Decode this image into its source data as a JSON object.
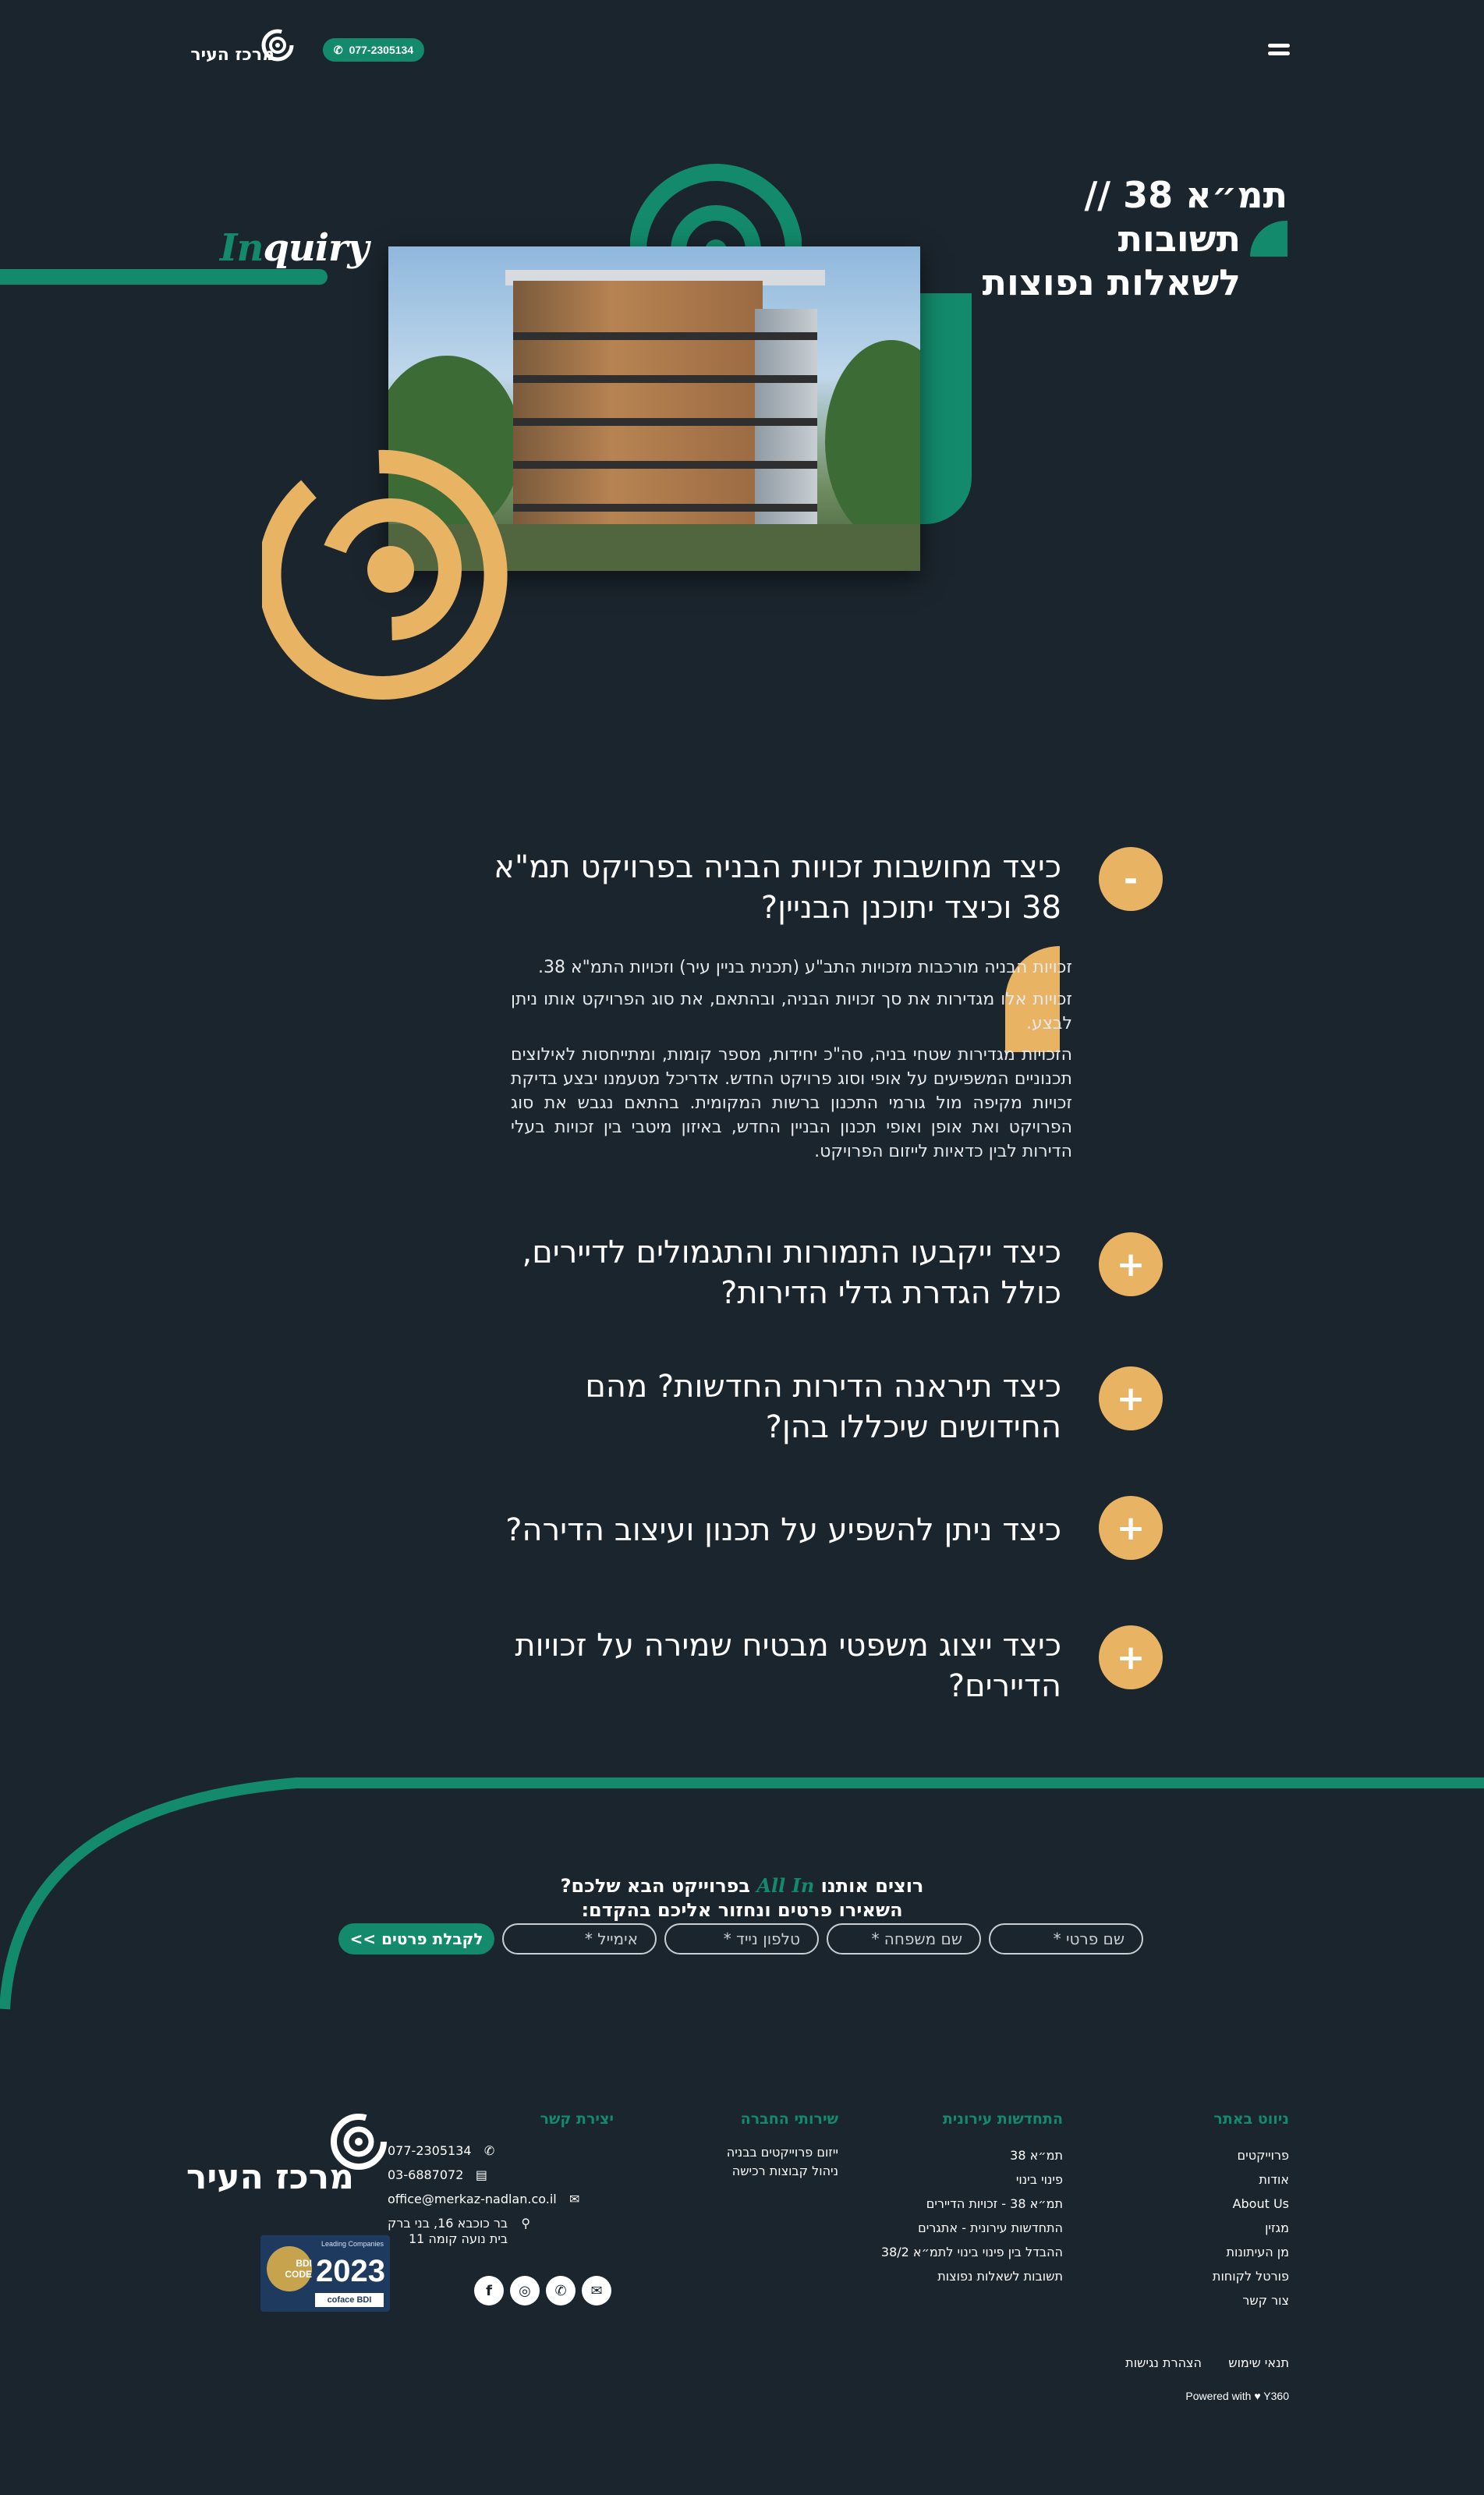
{
  "header": {
    "phone": "077-2305134",
    "logo_text": "מרכז העיר"
  },
  "hero": {
    "title_line1": "תמ״א 38 //",
    "title_line2": "תשובות",
    "title_line3": "לשאלות נפוצות",
    "inquiry_accent": "In",
    "inquiry_rest": "quiry"
  },
  "faq": [
    {
      "question": "כיצד מחושבות זכויות הבניה בפרויקט תמ\"א 38 וכיצד יתוכנן הבניין?",
      "toggle": "-",
      "answer": [
        "זכויות הבניה מורכבות מזכויות התב\"ע (תכנית בניין עיר) וזכויות התמ\"א 38.",
        "זכויות אלו מגדירות את סך זכויות הבניה, ובהתאם, את סוג הפרויקט אותו ניתן לבצע.",
        "הזכויות מגדירות שטחי בניה, סה\"כ יחידות, מספר קומות, ומתייחסות לאילוצים תכנוניים המשפיעים על אופי וסוג פרויקט החדש. אדריכל מטעמנו יבצע בדיקת זכויות מקיפה מול גורמי התכנון ברשות המקומית. בהתאם נגבש את סוג הפרויקט ואת אופן ואופי תכנון הבניין החדש, באיזון מיטבי בין זכויות בעלי הדירות לבין כדאיות לייזום הפרויקט."
      ]
    },
    {
      "question": "כיצד ייקבעו התמורות והתגמולים לדיירים, כולל הגדרת גדלי הדירות?",
      "toggle": "+"
    },
    {
      "question": "כיצד תיראנה הדירות החדשות? מהם החידושים שיכללו בהן?",
      "toggle": "+"
    },
    {
      "question": "כיצד ניתן להשפיע על תכנון ועיצוב הדירה?",
      "toggle": "+"
    },
    {
      "question": "כיצד ייצוג משפטי מבטיח שמירה על זכויות הדיירים?",
      "toggle": "+"
    }
  ],
  "contact": {
    "title_pre": "רוצים אותנו",
    "title_accent": "All In",
    "title_post": "בפרוייקט הבא שלכם?",
    "subtitle": "השאירו פרטים ונחזור אליכם בהקדם:",
    "first_name_placeholder": "שם פרטי *",
    "last_name_placeholder": "שם משפחה *",
    "phone_placeholder": "טלפון נייד *",
    "email_placeholder": "אימייל *",
    "submit": "לקבלת פרטים >>"
  },
  "footer": {
    "nav": {
      "heading": "ניווט באתר",
      "items": [
        "פרוייקטים",
        "אודות",
        "About Us",
        "מגזין",
        "מן העיתונות",
        "פורטל לקוחות",
        "צור קשר"
      ]
    },
    "renewal": {
      "heading": "התחדשות עירונית",
      "items": [
        "תמ״א 38",
        "פינוי בינוי",
        "תמ״א 38 - זכויות הדיירים",
        "התחדשות עירונית - אתגרים",
        "ההבדל בין פינוי בינוי לתמ״א 38/2",
        "תשובות לשאלות נפוצות"
      ]
    },
    "services": {
      "heading": "שירותי החברה",
      "items": [
        "ייזום פרוייקטים בבניה",
        "ניהול קבוצות רכישה"
      ]
    },
    "contact": {
      "heading": "יצירת קשר",
      "phone": "077-2305134",
      "fax": "03-6887072",
      "email": "office@merkaz-nadlan.co.il",
      "address_line1": "בר כוכבא 16, בני ברק",
      "address_line2": "בית נועה קומה 11"
    },
    "logo_text": "מרכז העיר",
    "badge": {
      "small": "Leading Companies",
      "year": "2023",
      "medal": "BDI CODE",
      "brand": "coface BDI"
    },
    "legal": {
      "terms": "תנאי שימוש",
      "accessibility": "הצהרת נגישות"
    },
    "powered": "Powered with ♥ Y360"
  }
}
